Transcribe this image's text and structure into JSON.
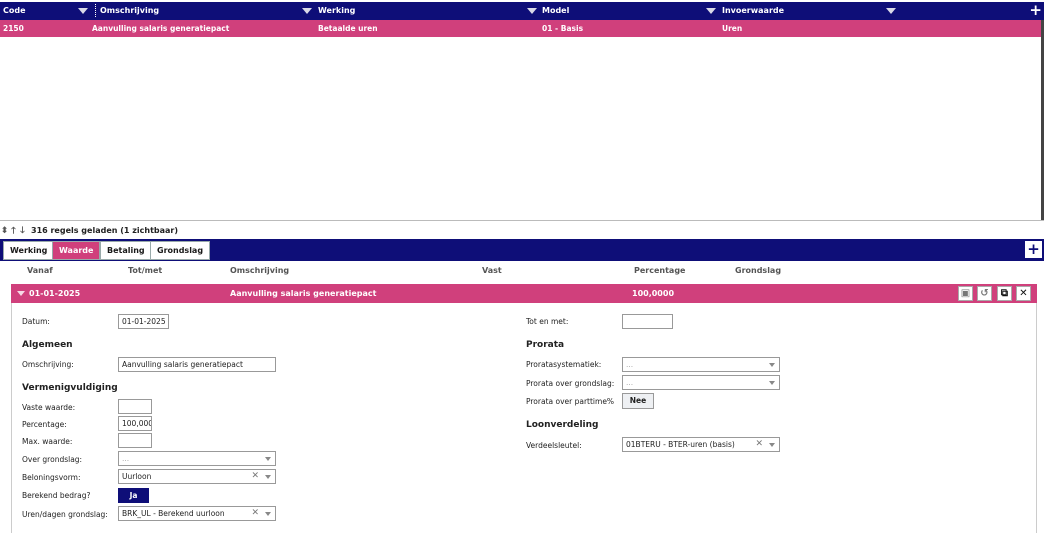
{
  "grid": {
    "columns": [
      {
        "label": "Code"
      },
      {
        "label": "Omschrijving"
      },
      {
        "label": "Werking"
      },
      {
        "label": "Model"
      },
      {
        "label": "Invoerwaarde"
      }
    ],
    "add_label": "+",
    "rows": [
      {
        "code": "2150",
        "omschrijving": "Aanvulling salaris generatiepact",
        "werking": "Betaalde uren",
        "model": "01 - Basis",
        "invoerwaarde": "Uren"
      }
    ]
  },
  "status": {
    "text": "316 regels geladen (1 zichtbaar)",
    "icons": [
      "sort-icon",
      "arrow-up-icon",
      "arrow-down-icon"
    ]
  },
  "tabs": [
    {
      "label": "Werking",
      "active": false
    },
    {
      "label": "Waarde",
      "active": true
    },
    {
      "label": "Betaling",
      "active": false
    },
    {
      "label": "Grondslag",
      "active": false
    }
  ],
  "tab_add_label": "+",
  "subheader": {
    "vanaf": "Vanaf",
    "totmet": "Tot/met",
    "omschrijving": "Omschrijving",
    "vast": "Vast",
    "percentage": "Percentage",
    "grondslag": "Grondslag"
  },
  "detail_row": {
    "vanaf": "01-01-2025",
    "omschrijving": "Aanvulling salaris generatiepact",
    "percentage": "100,0000",
    "action_icons": [
      "save-icon",
      "undo-icon",
      "copy-icon",
      "close-icon"
    ]
  },
  "form": {
    "datum_label": "Datum:",
    "datum_value": "01-01-2025",
    "totenmet_label": "Tot en met:",
    "totenmet_value": "",
    "algemeen_title": "Algemeen",
    "omschrijving_label": "Omschrijving:",
    "omschrijving_value": "Aanvulling salaris generatiepact",
    "vermenigvuldiging_title": "Vermenigvuldiging",
    "vaste_waarde_label": "Vaste waarde:",
    "vaste_waarde_value": "",
    "percentage_label": "Percentage:",
    "percentage_value": "100,000",
    "max_waarde_label": "Max. waarde:",
    "max_waarde_value": "",
    "over_grondslag_label": "Over grondslag:",
    "over_grondslag_placeholder": "...",
    "beloningsvorm_label": "Beloningsvorm:",
    "beloningsvorm_value": "Uurloon",
    "berekend_bedrag_label": "Berekend bedrag?",
    "berekend_bedrag_value": "Ja",
    "uren_dagen_label": "Uren/dagen grondslag:",
    "uren_dagen_value": "BRK_UL - Berekend uurloon",
    "prorata_title": "Prorata",
    "prorata_systematiek_label": "Proratasystematiek:",
    "prorata_systematiek_placeholder": "...",
    "prorata_grondslag_label": "Prorata over grondslag:",
    "prorata_grondslag_placeholder": "...",
    "prorata_parttime_label": "Prorata over parttime%",
    "prorata_parttime_value": "Nee",
    "loonverdeling_title": "Loonverdeling",
    "verdeelsleutel_label": "Verdeelsleutel:",
    "verdeelsleutel_value": "01BTERU - BTER-uren (basis)"
  },
  "colors": {
    "header_navy": "#0e0e78",
    "row_pink": "#d0407c"
  }
}
